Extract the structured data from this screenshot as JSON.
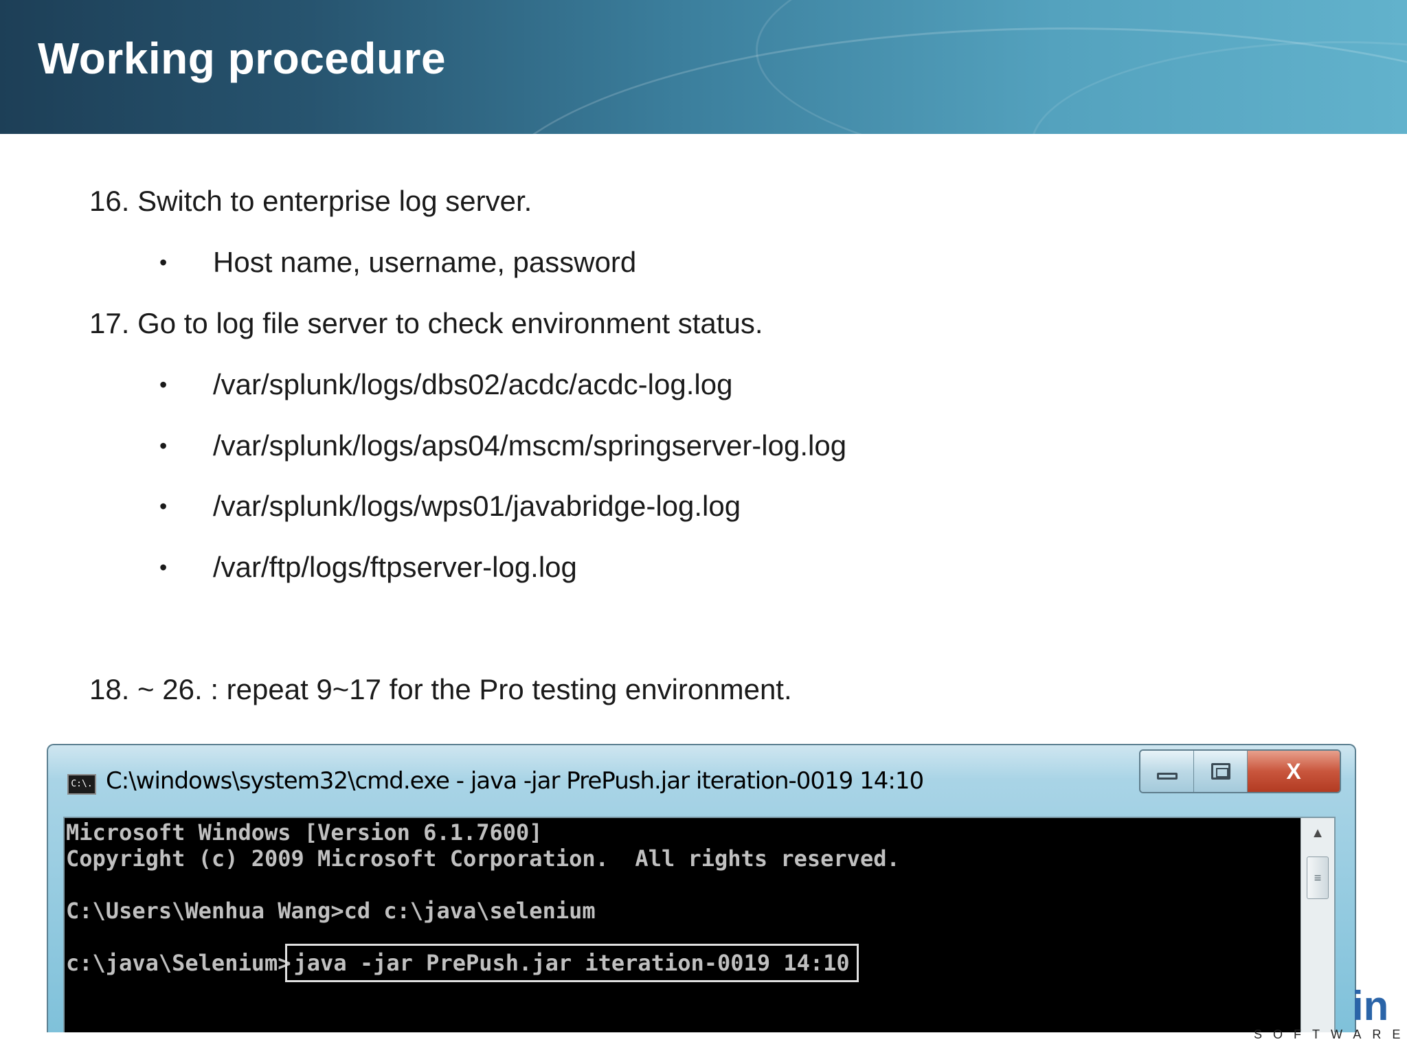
{
  "slide": {
    "title": "Working procedure"
  },
  "steps": [
    {
      "number": "16.",
      "text": "Switch to enterprise log server."
    },
    {
      "number": "17.",
      "text": "Go to log file server to check environment status."
    },
    {
      "number": "18. ~ 26.",
      "text": ": repeat 9~17 for the Pro testing environment."
    }
  ],
  "bullets": {
    "dot": "•",
    "step16": [
      "Host name, username, password"
    ],
    "step17": [
      "/var/splunk/logs/dbs02/acdc/acdc-log.log",
      "/var/splunk/logs/aps04/mscm/springserver-log.log",
      "/var/splunk/logs/wps01/javabridge-log.log",
      "/var/ftp/logs/ftpserver-log.log"
    ]
  },
  "cmd_window": {
    "icon_label": "C:\\.",
    "title": "C:\\windows\\system32\\cmd.exe - java  -jar PrePush.jar iteration-0019 14:10",
    "close_label": "X",
    "console": {
      "line1": "Microsoft Windows [Version 6.1.7600]",
      "line2": "Copyright (c) 2009 Microsoft Corporation.  All rights reserved.",
      "line3": "C:\\Users\\Wenhua Wang>cd c:\\java\\selenium",
      "line4_prompt": "c:\\java\\Selenium>",
      "line4_command": "java -jar PrePush.jar iteration-0019 14:10"
    }
  },
  "logo": {
    "fragment": "in",
    "subtitle": "SOFTWARE"
  },
  "icons": {
    "app": "cmd-app-icon",
    "minimize": "minimize-icon",
    "maximize": "maximize-icon",
    "close": "close-icon",
    "scroll_up": "arrow-up-icon",
    "scroll_thumb": "grip-icon"
  },
  "colors": {
    "header_dark": "#1d3f57",
    "header_light": "#62b2cc",
    "console_bg": "#000000",
    "console_text": "#c0c0c0",
    "close_red": "#c9563d"
  }
}
